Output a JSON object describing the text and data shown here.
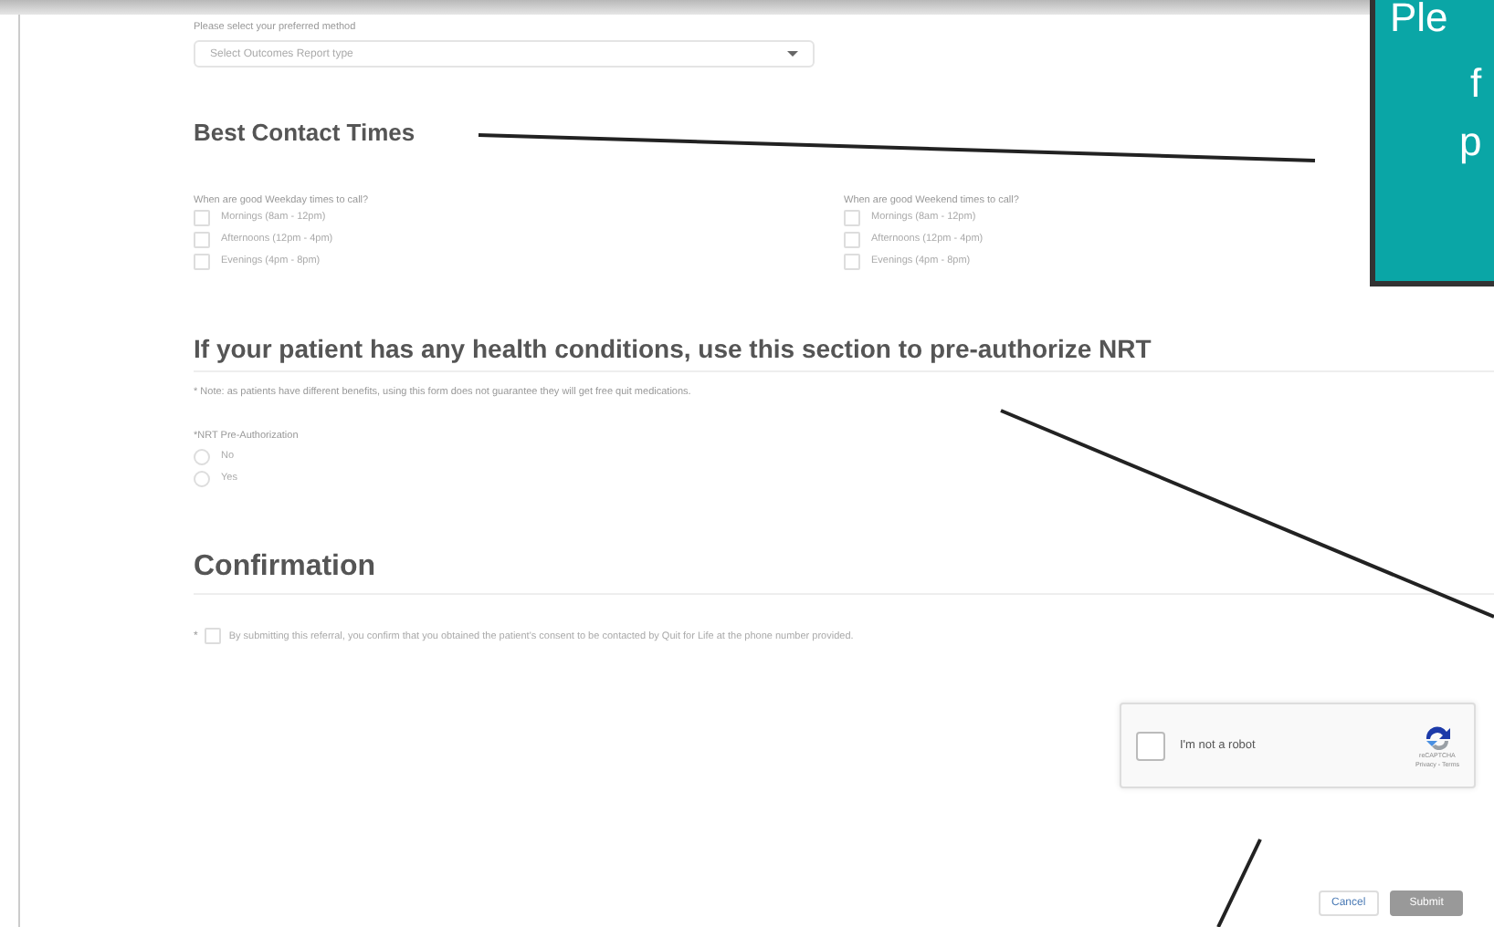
{
  "report_method": {
    "label": "Please select your preferred method",
    "placeholder": "Select Outcomes Report type"
  },
  "contact_times": {
    "heading": "Best Contact Times",
    "groups": [
      {
        "question": "When are good Weekday times to call?",
        "options": [
          {
            "label": "Mornings (8am - 12pm)",
            "checked": false
          },
          {
            "label": "Afternoons (12pm - 4pm)",
            "checked": false
          },
          {
            "label": "Evenings (4pm - 8pm)",
            "checked": false
          }
        ]
      },
      {
        "question": "When are good Weekend times to call?",
        "options": [
          {
            "label": "Mornings (8am - 12pm)",
            "checked": false
          },
          {
            "label": "Afternoons (12pm - 4pm)",
            "checked": false
          },
          {
            "label": "Evenings (4pm - 8pm)",
            "checked": false
          }
        ]
      }
    ]
  },
  "nrt": {
    "heading": "If your patient has any health conditions, use this section to pre-authorize NRT",
    "note": "* Note: as patients have different benefits, using this form does not guarantee they will get free quit medications.",
    "question": "*NRT Pre-Authorization",
    "options": [
      {
        "label": "No",
        "selected": false
      },
      {
        "label": "Yes",
        "selected": false
      }
    ]
  },
  "confirmation": {
    "heading": "Confirmation",
    "required_mark": "*",
    "consent": "By submitting this referral, you confirm that you obtained the patient's consent to be contacted by Quit for Life at the phone number provided.",
    "checked": false
  },
  "recaptcha": {
    "label": "I'm not a robot",
    "checked": false,
    "brand": "reCAPTCHA",
    "links": "Privacy - Terms"
  },
  "buttons": [
    {
      "label": "Cancel",
      "disabled": false
    },
    {
      "label": "Submit",
      "disabled": true
    }
  ],
  "callout": {
    "lines": [
      "Ple",
      "f",
      "p"
    ]
  }
}
